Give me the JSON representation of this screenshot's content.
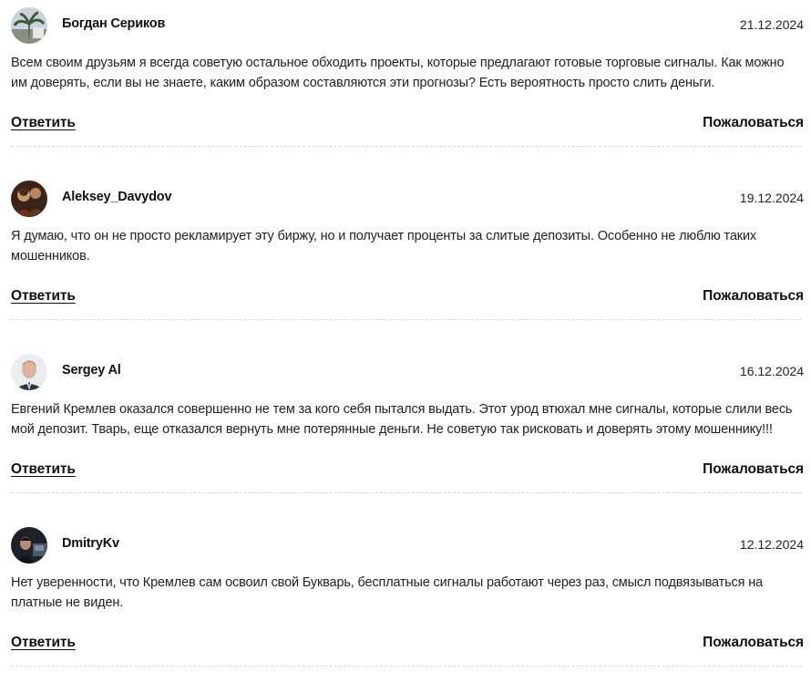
{
  "comments": [
    {
      "author": "Богдан Сериков",
      "date": "21.12.2024",
      "text": "Всем своим друзьям я всегда советую остальное обходить проекты, которые предлагают готовые торговые сигналы. Как можно им доверять, если вы не знаете, каким образом составляются эти прогнозы? Есть вероятность просто слить деньги.",
      "reply_label": "Ответить",
      "report_label": "Пожаловаться"
    },
    {
      "author": "Aleksey_Davydov",
      "date": "19.12.2024",
      "text": "Я думаю, что он не просто рекламирует эту биржу, но и получает проценты за слитые депозиты. Особенно не люблю таких мошенников.",
      "reply_label": "Ответить",
      "report_label": "Пожаловаться"
    },
    {
      "author": "Sergey Al",
      "date": "16.12.2024",
      "text": "Евгений Кремлев оказался совершенно не тем за кого себя пытался выдать. Этот урод втюхал мне сигналы, которые слили весь мой депозит. Тварь, еще отказался вернуть мне потерянные деньги. Не советую так рисковать и доверять этому мошеннику!!!",
      "reply_label": "Ответить",
      "report_label": "Пожаловаться"
    },
    {
      "author": "DmitryKv",
      "date": "12.12.2024",
      "text": "Нет уверенности, что Кремлев сам освоил свой Букварь, бесплатные сигналы работают через раз, смысл подвязываться на платные не виден.",
      "reply_label": "Ответить",
      "report_label": "Пожаловаться"
    }
  ],
  "colors": {
    "text": "#222222",
    "divider": "#d8d8d8"
  }
}
